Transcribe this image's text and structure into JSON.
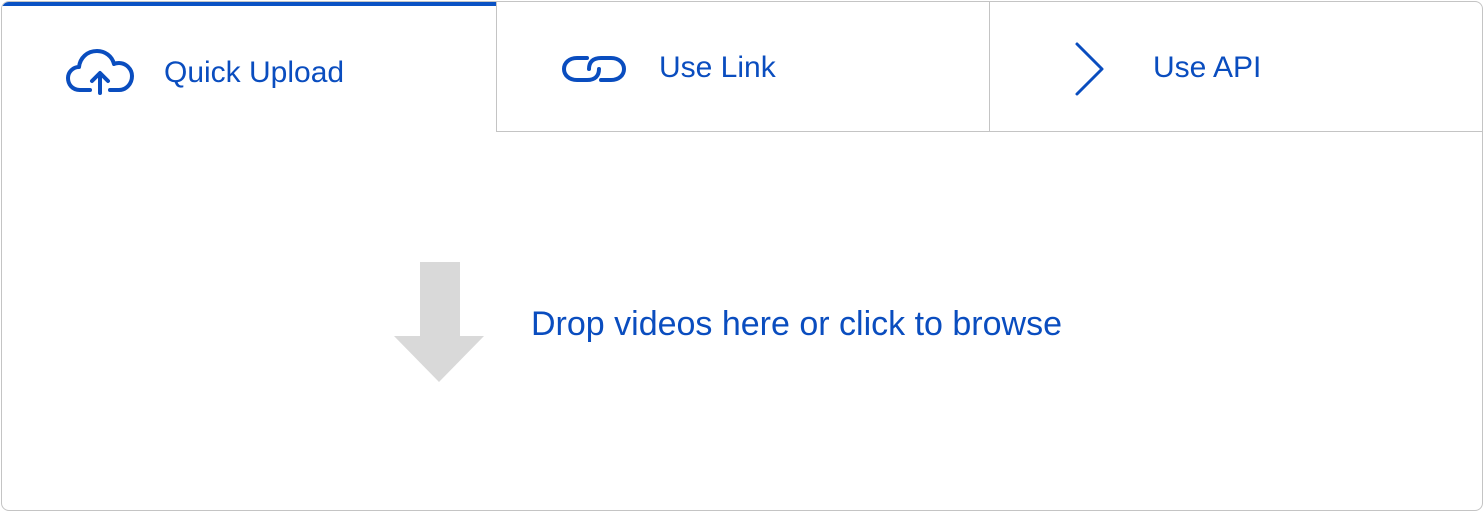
{
  "tabs": [
    {
      "label": "Quick Upload",
      "icon": "cloud-upload-icon",
      "active": true
    },
    {
      "label": "Use Link",
      "icon": "link-icon",
      "active": false
    },
    {
      "label": "Use API",
      "icon": "chevron-right-icon",
      "active": false
    }
  ],
  "dropzone": {
    "text": "Drop videos here or click to browse",
    "icon": "download-arrow-icon"
  },
  "colors": {
    "accent": "#0a4dbf",
    "active_tab_indicator": "#0a52c4",
    "border": "#c4c4c4",
    "arrow": "#d9d9d9"
  }
}
